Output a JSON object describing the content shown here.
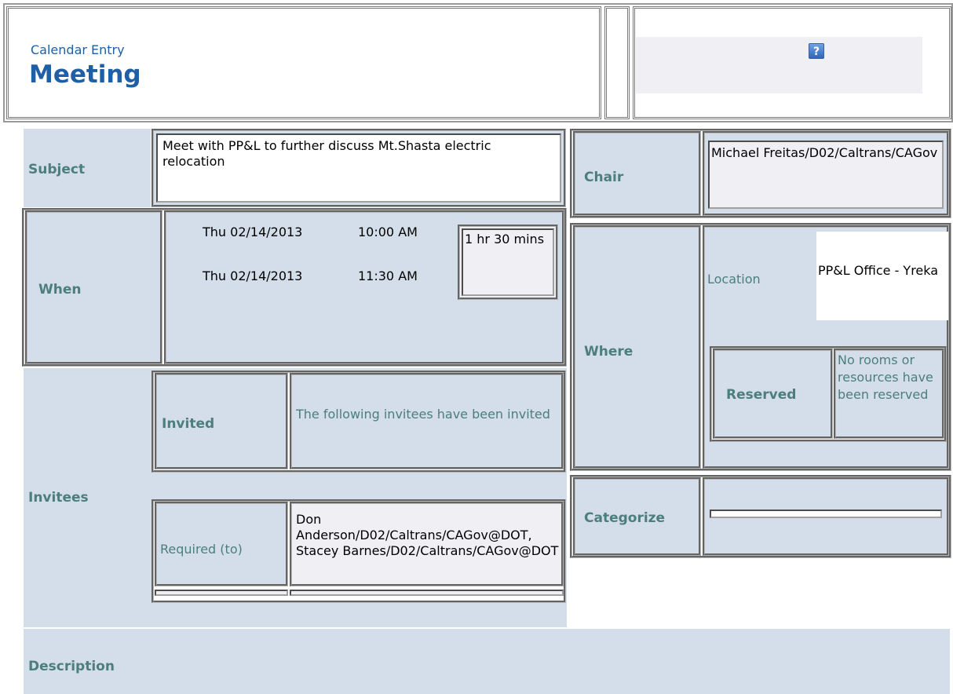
{
  "header": {
    "form_type": "Calendar Entry",
    "title": "Meeting",
    "help_icon": "help-question-icon"
  },
  "labels": {
    "subject": "Subject",
    "when": "When",
    "invitees": "Invitees",
    "invited": "Invited",
    "required": "Required (to)",
    "description": "Description",
    "chair": "Chair",
    "where": "Where",
    "location": "Location",
    "reserved": "Reserved",
    "categorize": "Categorize"
  },
  "subject": {
    "value": "Meet with PP&L to further discuss Mt.Shasta electric relocation"
  },
  "when": {
    "start_date": "Thu 02/14/2013",
    "start_time": "10:00 AM",
    "end_date": "Thu 02/14/2013",
    "end_time": "11:30 AM",
    "duration": "1 hr 30 mins"
  },
  "invitees": {
    "invited_text": "The following invitees have been invited",
    "required_value": "Don Anderson/D02/Caltrans/CAGov@DOT, Stacey Barnes/D02/Caltrans/CAGov@DOT"
  },
  "chair": {
    "value": "Michael Freitas/D02/Caltrans/CAGov"
  },
  "where": {
    "location_value": "PP&L Office - Yreka",
    "reserved_text": "No rooms or resources have been reserved"
  },
  "categorize": {
    "value": ""
  },
  "description": {
    "value": ""
  },
  "colors": {
    "title_blue": "#1f5fa6",
    "label_teal": "#4c7e7d",
    "panel_blue": "#d3deea",
    "field_lavender": "#efeff4"
  }
}
